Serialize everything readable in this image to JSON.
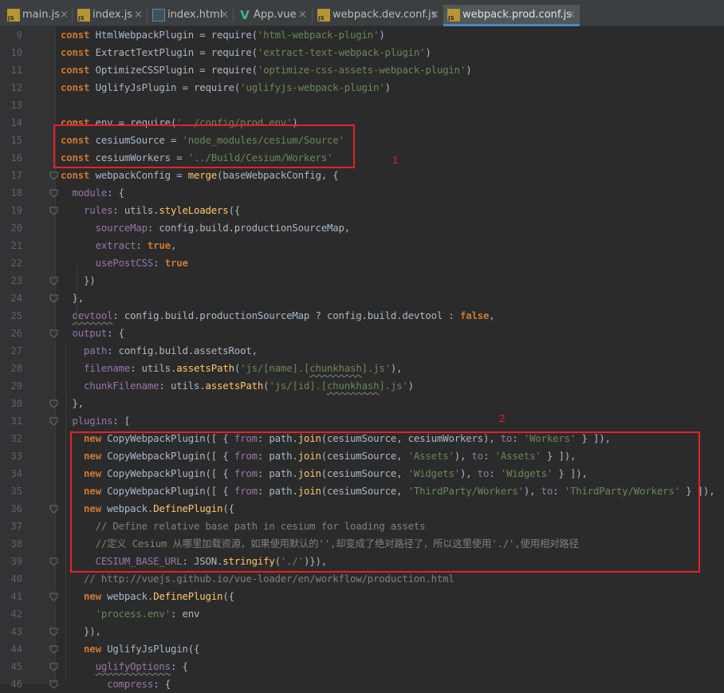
{
  "tabs": [
    {
      "label": "main.js",
      "icon": "js-file-icon",
      "badge": "JS",
      "active": false
    },
    {
      "label": "index.js",
      "icon": "js-file-icon",
      "badge": "JS",
      "active": false
    },
    {
      "label": "index.html",
      "icon": "html-file-icon",
      "badge": "",
      "active": false
    },
    {
      "label": "App.vue",
      "icon": "vue-file-icon",
      "badge": "V",
      "active": false
    },
    {
      "label": "webpack.dev.conf.js",
      "icon": "js-file-icon",
      "badge": "JS",
      "active": false
    },
    {
      "label": "webpack.prod.conf.js",
      "icon": "js-file-icon",
      "badge": "JS",
      "active": true
    }
  ],
  "close_glyph": "×",
  "line_numbers": [
    "9",
    "10",
    "11",
    "12",
    "13",
    "14",
    "15",
    "16",
    "17",
    "18",
    "19",
    "20",
    "21",
    "22",
    "23",
    "24",
    "25",
    "26",
    "27",
    "28",
    "29",
    "30",
    "31",
    "32",
    "33",
    "34",
    "35",
    "36",
    "37",
    "38",
    "39",
    "40",
    "41",
    "42",
    "43",
    "44",
    "45",
    "46"
  ],
  "code_lines": [
    [
      [
        "kw",
        "const "
      ],
      [
        "",
        "HtmlWebpackPlugin = require("
      ],
      [
        "str",
        "'html-webpack-plugin'"
      ],
      [
        "",
        ")"
      ]
    ],
    [
      [
        "kw",
        "const "
      ],
      [
        "",
        "ExtractTextPlugin = require("
      ],
      [
        "str",
        "'extract-text-webpack-plugin'"
      ],
      [
        "",
        ")"
      ]
    ],
    [
      [
        "kw",
        "const "
      ],
      [
        "",
        "OptimizeCSSPlugin = require("
      ],
      [
        "str",
        "'optimize-css-assets-webpack-plugin'"
      ],
      [
        "",
        ")"
      ]
    ],
    [
      [
        "kw",
        "const "
      ],
      [
        "",
        "UglifyJsPlugin = require("
      ],
      [
        "str",
        "'uglifyjs-webpack-plugin'"
      ],
      [
        "",
        ")"
      ]
    ],
    [],
    [
      [
        "kw",
        "const "
      ],
      [
        "",
        "env = require("
      ],
      [
        "str",
        "'../config/prod.env'"
      ],
      [
        "",
        ")"
      ]
    ],
    [
      [
        "kw",
        "const "
      ],
      [
        "",
        "cesiumSource = "
      ],
      [
        "str",
        "'node_modules/cesium/Source'"
      ]
    ],
    [
      [
        "kw",
        "const "
      ],
      [
        "",
        "cesiumWorkers = "
      ],
      [
        "str",
        "'../Build/Cesium/Workers'"
      ]
    ],
    [
      [
        "kw",
        "const "
      ],
      [
        "",
        "webpackConfig = "
      ],
      [
        "fn",
        "merge"
      ],
      [
        "",
        "(baseWebpackConfig, {"
      ]
    ],
    [
      [
        "",
        "  "
      ],
      [
        "prop",
        "module"
      ],
      [
        "",
        ": {"
      ]
    ],
    [
      [
        "",
        "    "
      ],
      [
        "prop",
        "rules"
      ],
      [
        "",
        ": utils."
      ],
      [
        "fn",
        "styleLoaders"
      ],
      [
        "",
        "({"
      ]
    ],
    [
      [
        "",
        "      "
      ],
      [
        "prop",
        "sourceMap"
      ],
      [
        "",
        ": config.build.productionSourceMap,"
      ]
    ],
    [
      [
        "",
        "      "
      ],
      [
        "prop",
        "extract"
      ],
      [
        "",
        ": "
      ],
      [
        "kw",
        "true"
      ],
      [
        "",
        ","
      ]
    ],
    [
      [
        "",
        "      "
      ],
      [
        "prop",
        "usePostCSS"
      ],
      [
        "",
        ": "
      ],
      [
        "kw",
        "true"
      ]
    ],
    [
      [
        "",
        "    })"
      ]
    ],
    [
      [
        "",
        "  },"
      ]
    ],
    [
      [
        "",
        "  "
      ],
      [
        "prop wav",
        "devtool"
      ],
      [
        "",
        ": config.build.productionSourceMap ? config.build.devtool : "
      ],
      [
        "kw",
        "false"
      ],
      [
        "",
        ","
      ]
    ],
    [
      [
        "",
        "  "
      ],
      [
        "prop",
        "output"
      ],
      [
        "",
        ": {"
      ]
    ],
    [
      [
        "",
        "    "
      ],
      [
        "prop",
        "path"
      ],
      [
        "",
        ": config.build.assetsRoot,"
      ]
    ],
    [
      [
        "",
        "    "
      ],
      [
        "prop",
        "filename"
      ],
      [
        "",
        ": utils."
      ],
      [
        "fn",
        "assetsPath"
      ],
      [
        "",
        "("
      ],
      [
        "str",
        "'js/[name].["
      ],
      [
        "str wav",
        "chunkhash"
      ],
      [
        "str",
        "].js'"
      ],
      [
        "",
        "),"
      ]
    ],
    [
      [
        "",
        "    "
      ],
      [
        "prop",
        "chunkFilename"
      ],
      [
        "",
        ": utils."
      ],
      [
        "fn",
        "assetsPath"
      ],
      [
        "",
        "("
      ],
      [
        "str",
        "'js/[id].["
      ],
      [
        "str wav",
        "chunkhash"
      ],
      [
        "str",
        "].js'"
      ],
      [
        "",
        ")"
      ]
    ],
    [
      [
        "",
        "  },"
      ]
    ],
    [
      [
        "",
        "  "
      ],
      [
        "prop",
        "plugins"
      ],
      [
        "",
        ": ["
      ]
    ],
    [
      [
        "",
        "    "
      ],
      [
        "kw",
        "new "
      ],
      [
        "",
        "CopyWebpackPlugin([ { "
      ],
      [
        "prop",
        "from"
      ],
      [
        "",
        ": path."
      ],
      [
        "fn",
        "join"
      ],
      [
        "",
        "(cesiumSource, cesiumWorkers), "
      ],
      [
        "prop",
        "to"
      ],
      [
        "",
        ": "
      ],
      [
        "str",
        "'Workers'"
      ],
      [
        "",
        " } ]),"
      ]
    ],
    [
      [
        "",
        "    "
      ],
      [
        "kw",
        "new "
      ],
      [
        "",
        "CopyWebpackPlugin([ { "
      ],
      [
        "prop",
        "from"
      ],
      [
        "",
        ": path."
      ],
      [
        "fn",
        "join"
      ],
      [
        "",
        "(cesiumSource, "
      ],
      [
        "str",
        "'Assets'"
      ],
      [
        "",
        "), "
      ],
      [
        "prop",
        "to"
      ],
      [
        "",
        ": "
      ],
      [
        "str",
        "'Assets'"
      ],
      [
        "",
        " } ]),"
      ]
    ],
    [
      [
        "",
        "    "
      ],
      [
        "kw",
        "new "
      ],
      [
        "",
        "CopyWebpackPlugin([ { "
      ],
      [
        "prop",
        "from"
      ],
      [
        "",
        ": path."
      ],
      [
        "fn",
        "join"
      ],
      [
        "",
        "(cesiumSource, "
      ],
      [
        "str",
        "'Widgets'"
      ],
      [
        "",
        "), "
      ],
      [
        "prop",
        "to"
      ],
      [
        "",
        ": "
      ],
      [
        "str",
        "'Widgets'"
      ],
      [
        "",
        " } ]),"
      ]
    ],
    [
      [
        "",
        "    "
      ],
      [
        "kw",
        "new "
      ],
      [
        "",
        "CopyWebpackPlugin([ { "
      ],
      [
        "prop",
        "from"
      ],
      [
        "",
        ": path."
      ],
      [
        "fn",
        "join"
      ],
      [
        "",
        "(cesiumSource, "
      ],
      [
        "str",
        "'ThirdParty/Workers'"
      ],
      [
        "",
        "), "
      ],
      [
        "prop",
        "to"
      ],
      [
        "",
        ": "
      ],
      [
        "str",
        "'ThirdParty/Workers'"
      ],
      [
        "",
        " } ]),"
      ]
    ],
    [
      [
        "",
        "    "
      ],
      [
        "kw",
        "new "
      ],
      [
        "",
        "webpack."
      ],
      [
        "fn",
        "DefinePlugin"
      ],
      [
        "",
        "({"
      ]
    ],
    [
      [
        "",
        "      "
      ],
      [
        "cm",
        "// Define relative base path in cesium for loading assets"
      ]
    ],
    [
      [
        "",
        "      "
      ],
      [
        "cm",
        "//定义 Cesium 从哪里加载资源，如果使用默认的'',却变成了绝对路径了，所以这里使用'./',使用相对路径"
      ]
    ],
    [
      [
        "",
        "      "
      ],
      [
        "prop",
        "CESIUM_BASE_URL"
      ],
      [
        "",
        ": JSON."
      ],
      [
        "fn",
        "stringify"
      ],
      [
        "",
        "("
      ],
      [
        "str",
        "'./'"
      ],
      [
        "",
        ")}),"
      ]
    ],
    [
      [
        "",
        "    "
      ],
      [
        "cm",
        "// http://vuejs.github.io/vue-loader/en/workflow/production.html"
      ]
    ],
    [
      [
        "",
        "    "
      ],
      [
        "kw",
        "new "
      ],
      [
        "",
        "webpack."
      ],
      [
        "fn",
        "DefinePlugin"
      ],
      [
        "",
        "({"
      ]
    ],
    [
      [
        "",
        "      "
      ],
      [
        "str",
        "'process.env'"
      ],
      [
        "",
        ": env"
      ]
    ],
    [
      [
        "",
        "    }),"
      ]
    ],
    [
      [
        "",
        "    "
      ],
      [
        "kw",
        "new "
      ],
      [
        "",
        "UglifyJsPlugin({"
      ]
    ],
    [
      [
        "",
        "      "
      ],
      [
        "prop wav",
        "uglifyOptions"
      ],
      [
        "",
        ": {"
      ]
    ],
    [
      [
        "",
        "        "
      ],
      [
        "prop",
        "compress"
      ],
      [
        "",
        ": {"
      ]
    ]
  ],
  "annotations": [
    "1",
    "2"
  ],
  "colors": {
    "editor_bg": "#2b2b2b",
    "gutter_bg": "#313335",
    "highlight_box": "#e8202a",
    "active_tab_underline": "#4a88c7"
  }
}
